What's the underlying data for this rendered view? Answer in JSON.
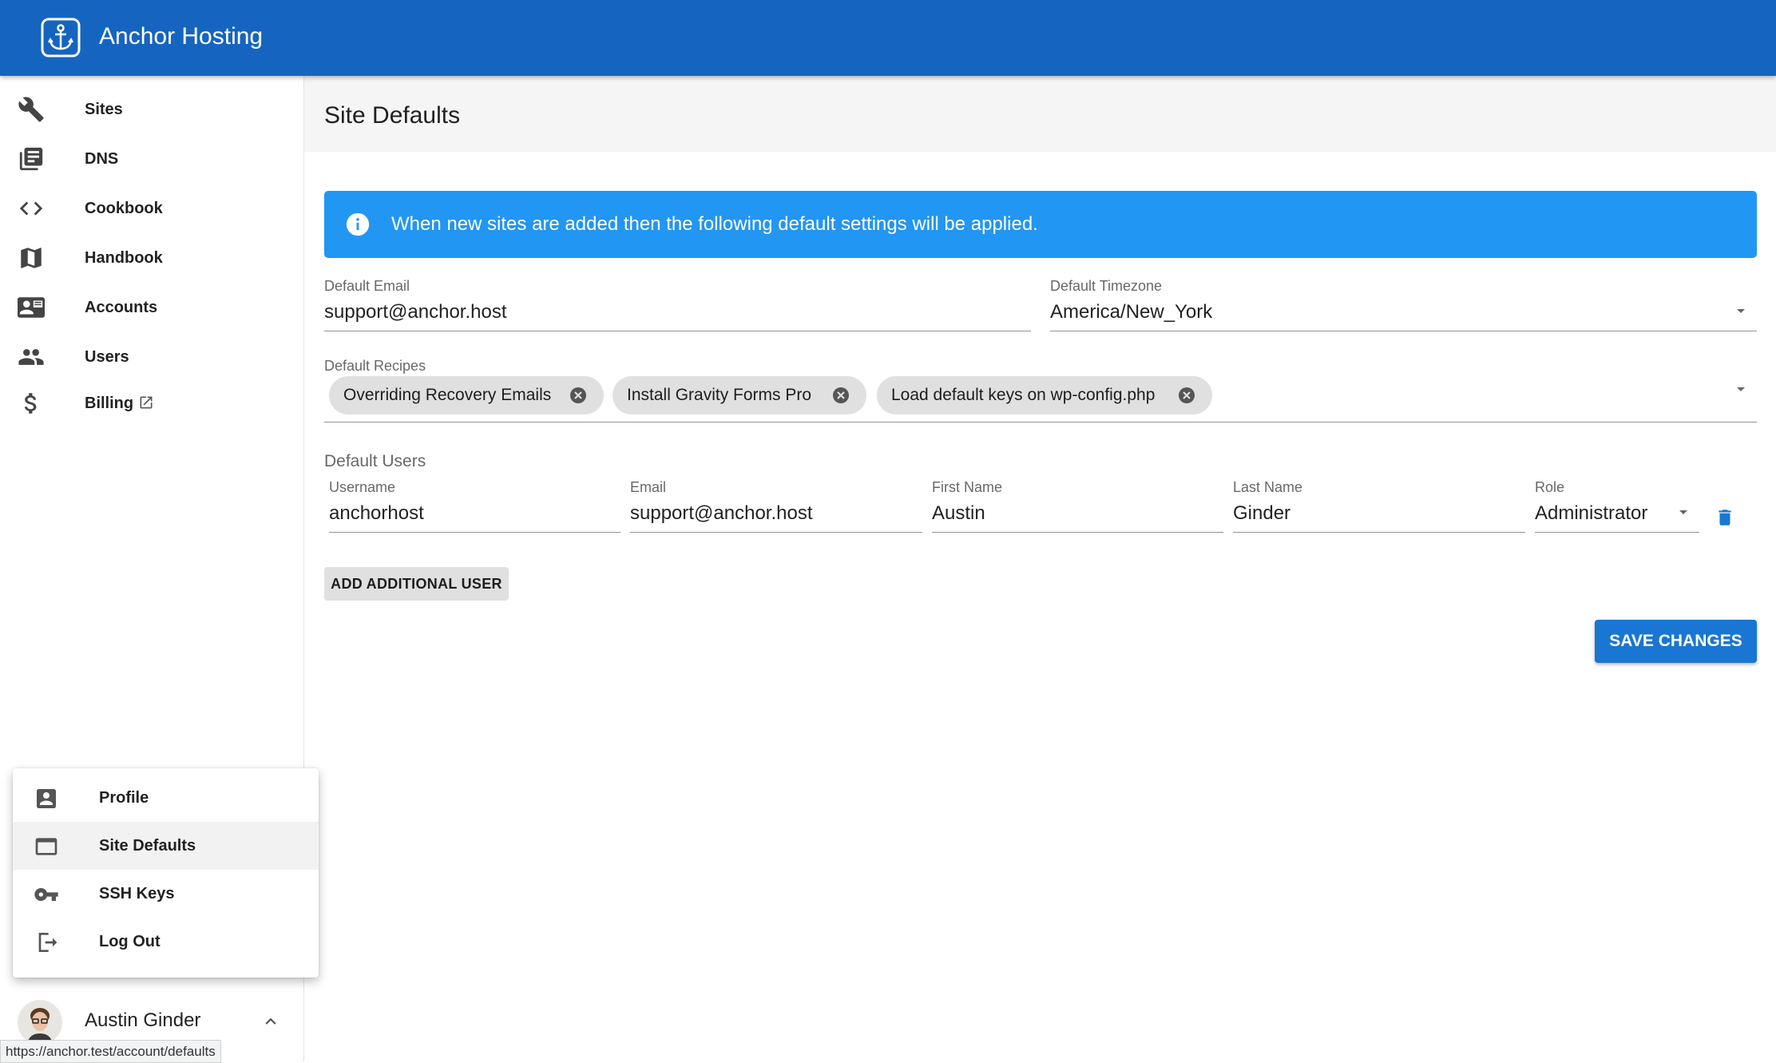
{
  "app": {
    "title": "Anchor Hosting",
    "logo_icon": "anchor-icon",
    "brand_color": "#1565c0"
  },
  "sidebar": {
    "items": [
      {
        "label": "Sites",
        "icon": "wrench-icon"
      },
      {
        "label": "DNS",
        "icon": "library-books-icon"
      },
      {
        "label": "Cookbook",
        "icon": "code-icon"
      },
      {
        "label": "Handbook",
        "icon": "map-icon"
      },
      {
        "label": "Accounts",
        "icon": "account-card-icon"
      },
      {
        "label": "Users",
        "icon": "users-icon"
      },
      {
        "label": "Billing",
        "icon": "dollar-icon",
        "external": true
      }
    ]
  },
  "page": {
    "title": "Site Defaults"
  },
  "alert": {
    "text": "When new sites are added then the following default settings will be applied.",
    "color": "#2196f3"
  },
  "form": {
    "default_email": {
      "label": "Default Email",
      "value": "support@anchor.host"
    },
    "default_timezone": {
      "label": "Default Timezone",
      "value": "America/New_York"
    },
    "default_recipes": {
      "label": "Default Recipes",
      "chips": [
        "Overriding Recovery Emails",
        "Install Gravity Forms Pro",
        "Load default keys on wp-config.php"
      ]
    },
    "default_users": {
      "label": "Default Users",
      "columns": {
        "username": "Username",
        "email": "Email",
        "first_name": "First Name",
        "last_name": "Last Name",
        "role": "Role"
      },
      "rows": [
        {
          "username": "anchorhost",
          "email": "support@anchor.host",
          "first_name": "Austin",
          "last_name": "Ginder",
          "role": "Administrator"
        }
      ]
    },
    "add_user_label": "ADD ADDITIONAL USER",
    "save_label": "SAVE CHANGES"
  },
  "account_menu": {
    "items": [
      {
        "label": "Profile",
        "icon": "account-box-icon"
      },
      {
        "label": "Site Defaults",
        "icon": "browser-window-icon",
        "active": true
      },
      {
        "label": "SSH Keys",
        "icon": "key-icon"
      },
      {
        "label": "Log Out",
        "icon": "logout-icon"
      }
    ]
  },
  "user": {
    "name": "Austin Ginder"
  },
  "status_bar": {
    "url": "https://anchor.test/account/defaults"
  }
}
